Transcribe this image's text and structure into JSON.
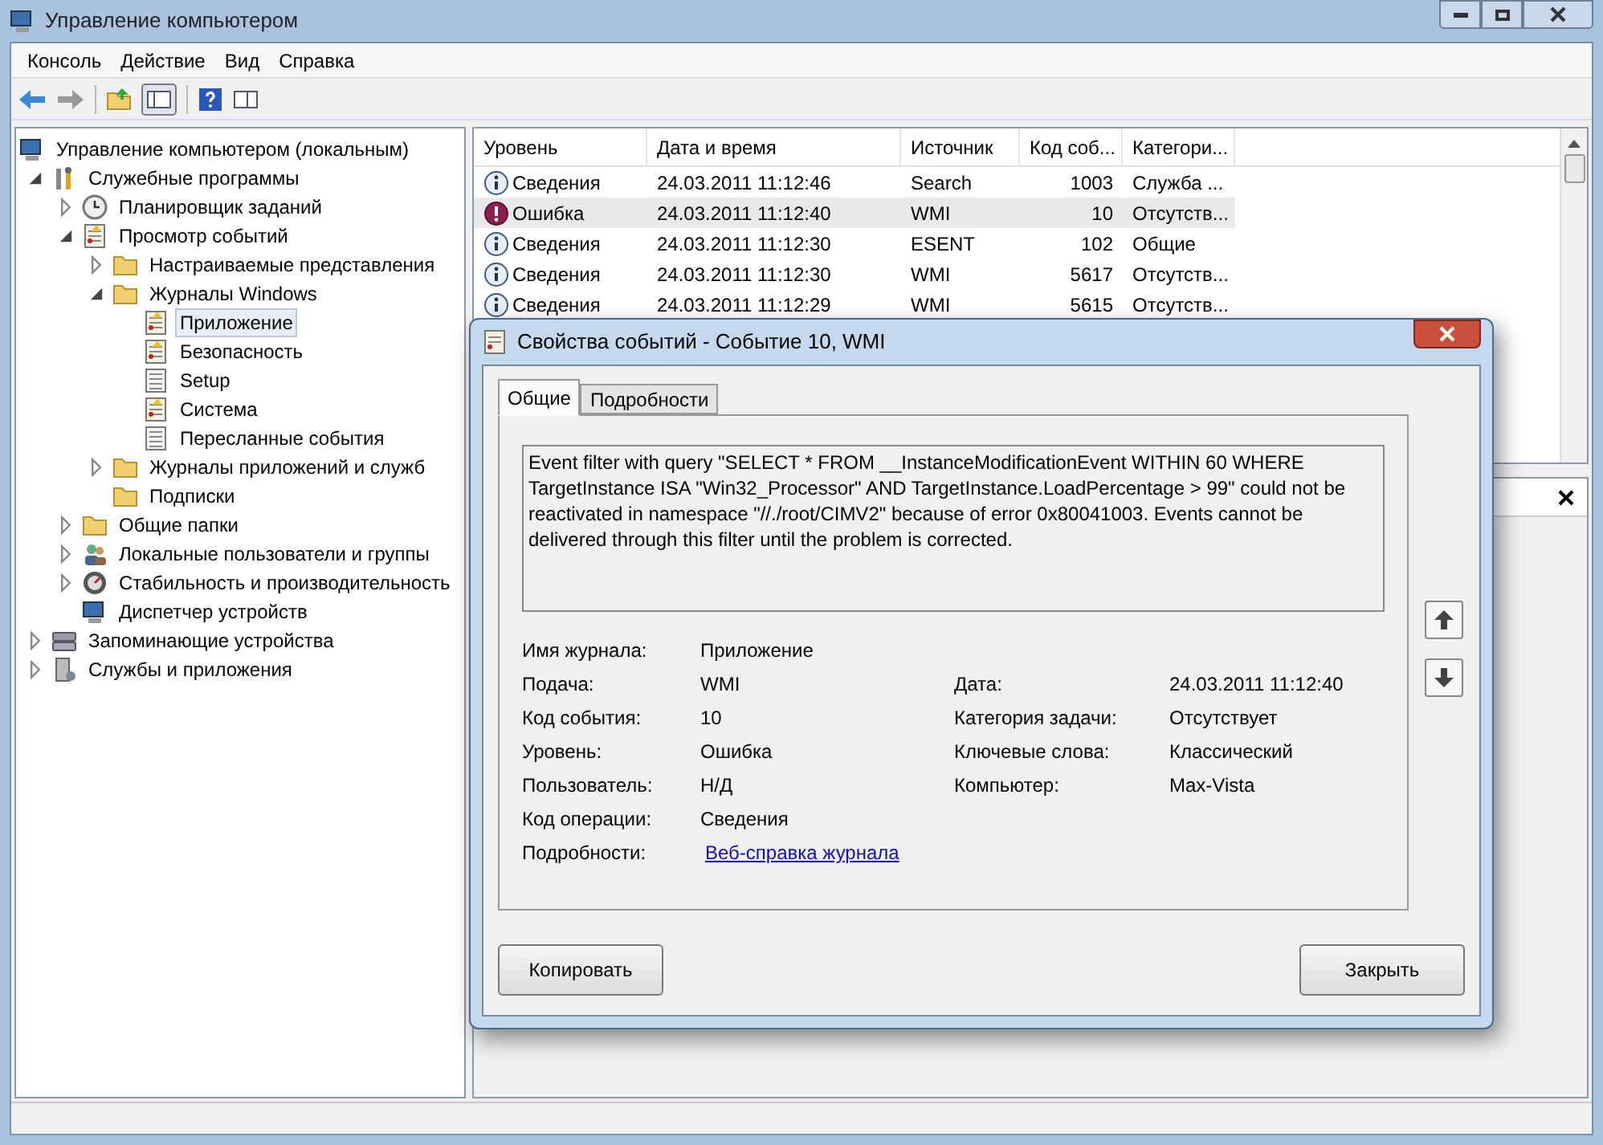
{
  "window": {
    "title": "Управление компьютером"
  },
  "menu": [
    "Консоль",
    "Действие",
    "Вид",
    "Справка"
  ],
  "tree": [
    {
      "label": "Управление компьютером (локальным)",
      "kind": "computer",
      "selected": false,
      "children": [
        {
          "label": "Служебные программы",
          "kind": "tools",
          "expanded": true,
          "selected": false,
          "children": [
            {
              "label": "Планировщик заданий",
              "kind": "clock",
              "expanded": false,
              "selected": false
            },
            {
              "label": "Просмотр событий",
              "kind": "log",
              "expanded": true,
              "selected": false,
              "children": [
                {
                  "label": "Настраиваемые представления",
                  "kind": "folder",
                  "expanded": false,
                  "selected": false
                },
                {
                  "label": "Журналы Windows",
                  "kind": "folder",
                  "expanded": true,
                  "selected": false,
                  "children": [
                    {
                      "label": "Приложение",
                      "kind": "log",
                      "selected": true
                    },
                    {
                      "label": "Безопасность",
                      "kind": "log",
                      "selected": false
                    },
                    {
                      "label": "Setup",
                      "kind": "list",
                      "selected": false
                    },
                    {
                      "label": "Система",
                      "kind": "log",
                      "selected": false
                    },
                    {
                      "label": "Пересланные события",
                      "kind": "list",
                      "selected": false
                    }
                  ]
                },
                {
                  "label": "Журналы приложений и служб",
                  "kind": "folder",
                  "expanded": false,
                  "selected": false
                },
                {
                  "label": "Подписки",
                  "kind": "folder",
                  "selected": false
                }
              ]
            },
            {
              "label": "Общие папки",
              "kind": "folder",
              "expanded": false,
              "selected": false
            },
            {
              "label": "Локальные пользователи и группы",
              "kind": "users",
              "expanded": false,
              "selected": false
            },
            {
              "label": "Стабильность и производительность",
              "kind": "gauge",
              "expanded": false,
              "selected": false
            },
            {
              "label": "Диспетчер устройств",
              "kind": "computer",
              "selected": false
            }
          ]
        },
        {
          "label": "Запоминающие устройства",
          "kind": "storage",
          "expanded": false,
          "selected": false
        },
        {
          "label": "Службы и приложения",
          "kind": "server",
          "expanded": false,
          "selected": false
        }
      ]
    }
  ],
  "table": {
    "columns": [
      "Уровень",
      "Дата и время",
      "Источник",
      "Код соб...",
      "Категори..."
    ],
    "rows": [
      {
        "kind": "info",
        "level": "Сведения",
        "date": "24.03.2011 11:12:46",
        "source": "Search",
        "code": "1003",
        "category": "Служба ...",
        "selected": false
      },
      {
        "kind": "error",
        "level": "Ошибка",
        "date": "24.03.2011 11:12:40",
        "source": "WMI",
        "code": "10",
        "category": "Отсутств...",
        "selected": true
      },
      {
        "kind": "info",
        "level": "Сведения",
        "date": "24.03.2011 11:12:30",
        "source": "ESENT",
        "code": "102",
        "category": "Общие",
        "selected": false
      },
      {
        "kind": "info",
        "level": "Сведения",
        "date": "24.03.2011 11:12:30",
        "source": "WMI",
        "code": "5617",
        "category": "Отсутств...",
        "selected": false
      },
      {
        "kind": "info",
        "level": "Сведения",
        "date": "24.03.2011 11:12:29",
        "source": "WMI",
        "code": "5615",
        "category": "Отсутств...",
        "selected": false
      }
    ]
  },
  "dialog": {
    "title": "Свойства событий - Событие 10, WMI",
    "tabs": [
      {
        "label": "Общие",
        "selected": true
      },
      {
        "label": "Подробности",
        "selected": false
      }
    ],
    "description": "Event filter with query \"SELECT * FROM __InstanceModificationEvent WITHIN 60 WHERE TargetInstance ISA \"Win32_Processor\" AND TargetInstance.LoadPercentage > 99\" could not be reactivated in namespace \"//./root/CIMV2\" because of error 0x80041003. Events cannot be delivered through this filter until the problem is corrected.",
    "rows": [
      {
        "left": {
          "label": "Имя журнала:",
          "value": "Приложение"
        }
      },
      {
        "left": {
          "label": "Подача:",
          "value": "WMI"
        },
        "right": {
          "label": "Дата:",
          "value": "24.03.2011 11:12:40"
        }
      },
      {
        "left": {
          "label": "Код события:",
          "value": "10"
        },
        "right": {
          "label": "Категория задачи:",
          "value": "Отсутствует"
        }
      },
      {
        "left": {
          "label": "Уровень:",
          "value": "Ошибка"
        },
        "right": {
          "label": "Ключевые слова:",
          "value": "Классический"
        }
      },
      {
        "left": {
          "label": "Пользователь:",
          "value": "Н/Д"
        },
        "right": {
          "label": "Компьютер:",
          "value": "Max-Vista"
        }
      },
      {
        "left": {
          "label": "Код операции:",
          "value": "Сведения"
        }
      },
      {
        "left": {
          "label": "Подробности:",
          "value": "Веб-справка журнала",
          "kind": "link"
        }
      }
    ],
    "buttons": [
      "Копировать",
      "Закрыть"
    ]
  }
}
